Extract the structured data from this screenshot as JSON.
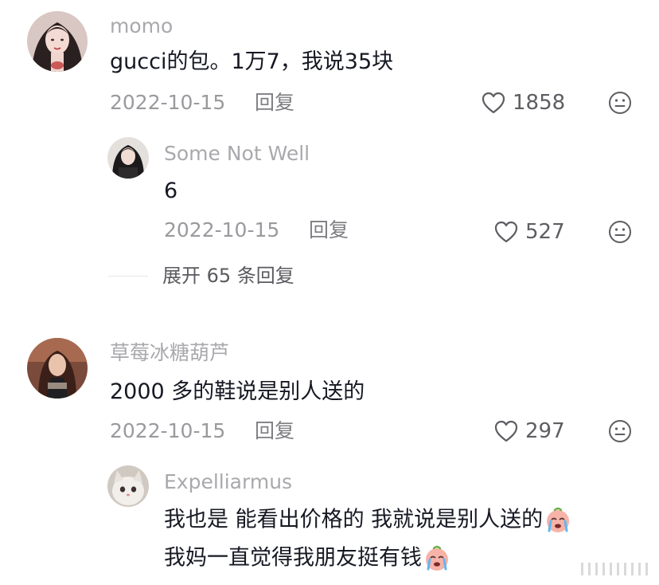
{
  "comments": [
    {
      "username": "momo",
      "text": "gucci的包。1万7，我说35块",
      "date": "2022-10-15",
      "reply_label": "回复",
      "likes": "1858",
      "replies": [
        {
          "username": "Some Not Well",
          "text": "6",
          "date": "2022-10-15",
          "reply_label": "回复",
          "likes": "527"
        }
      ],
      "expand_label": "展开 65 条回复"
    },
    {
      "username": "草莓冰糖葫芦",
      "text": "2000 多的鞋说是别人送的",
      "date": "2022-10-15",
      "reply_label": "回复",
      "likes": "297",
      "replies": [
        {
          "username": "Expelliarmus",
          "text_line1": "我也是 能看出价格的 我就说是别人送的",
          "text_line2": "我妈一直觉得我朋友挺有钱"
        }
      ]
    }
  ],
  "icons": {
    "like": "heart-outline-icon",
    "emoji": "smiley-face-icon",
    "cry": "crying-face-emoji"
  },
  "colors": {
    "username": "#a9a9ad",
    "content": "#161823",
    "meta": "#9a9a9e"
  }
}
